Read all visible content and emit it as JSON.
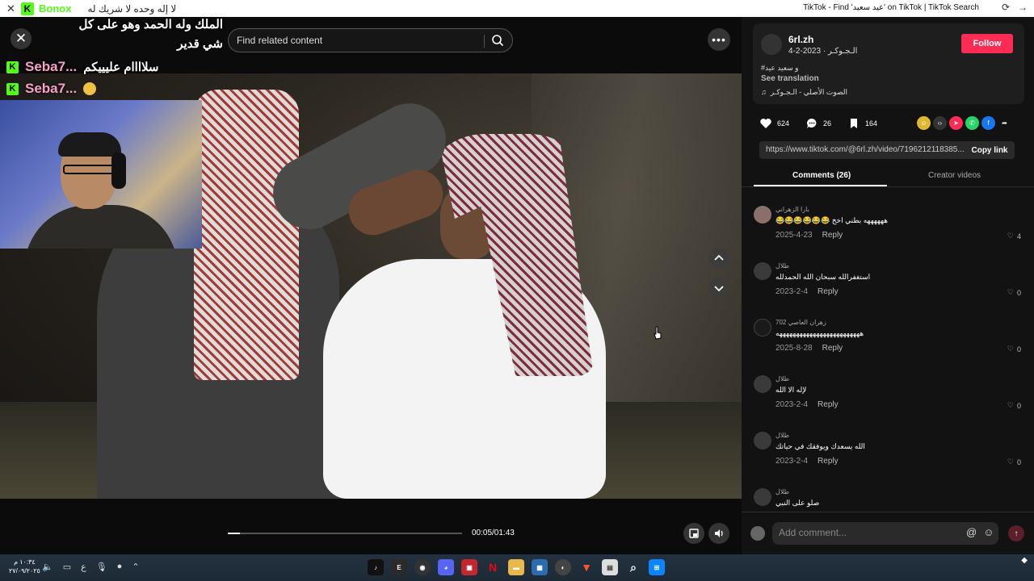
{
  "titlebar": {
    "brand": "Bonox",
    "marquee": "لا إله وحده لا شريك له",
    "page_title": "TikTok - Find 'عيد سعيد' on TikTok | TikTok Search"
  },
  "chat": {
    "top_message_line1": "الملك وله الحمد وهو على كل",
    "top_message_line2": "شي قدير",
    "lines": [
      {
        "user": "Seba7...",
        "message": "سلاااام عليييكم"
      },
      {
        "user": "Seba7...",
        "message": ""
      }
    ]
  },
  "player": {
    "search_placeholder": "Find related content",
    "time": "00:05/01:43",
    "progress": 0.05
  },
  "author": {
    "name": "6rl.zh",
    "subtitle": "الـجـوكـر · 2023-2-4",
    "follow_label": "Follow",
    "description": "#و سعيد عيد",
    "see_translation": "See translation",
    "music": "الصوت الأصلي - الـجـوكـر"
  },
  "stats": {
    "likes": "624",
    "comments": "26",
    "saves": "164"
  },
  "share": {
    "link": "https://www.tiktok.com/@6rl.zh/video/7196212118385...",
    "copy_label": "Copy link"
  },
  "tabs": {
    "comments": "Comments (26)",
    "creator_videos": "Creator videos"
  },
  "comments": [
    {
      "name": "بارا الزهراني",
      "text": "ههههههه بطني اخخ 😂😂😂😂😂😂",
      "date": "2025-4-23",
      "reply": "Reply",
      "likes": "4"
    },
    {
      "name": "طلال",
      "text": "استغفرالله سبحان الله الحمدلله",
      "date": "2023-2-4",
      "reply": "Reply",
      "likes": "0"
    },
    {
      "name": "زهران العاصي 702",
      "text": "هههههههههههههههههههههههههه",
      "date": "2025-8-28",
      "reply": "Reply",
      "likes": "0"
    },
    {
      "name": "طلال",
      "text": "لإله الا الله",
      "date": "2023-2-4",
      "reply": "Reply",
      "likes": "0"
    },
    {
      "name": "طلال",
      "text": "الله يسعدك ويوفقك في حياتك",
      "date": "2023-2-4",
      "reply": "Reply",
      "likes": "0"
    },
    {
      "name": "طلال",
      "text": "صلو على النبي",
      "date": "",
      "reply": "",
      "likes": ""
    }
  ],
  "add_comment": {
    "placeholder": "Add comment..."
  },
  "taskbar": {
    "time": "١٠:٣٤ م",
    "date": "٢٧/٠٩/٢٠٢٥",
    "lang": "ع"
  },
  "colors": {
    "follow": "#fe2c55",
    "kick_green": "#53fc18",
    "chat_user": "#f7a0c8"
  }
}
